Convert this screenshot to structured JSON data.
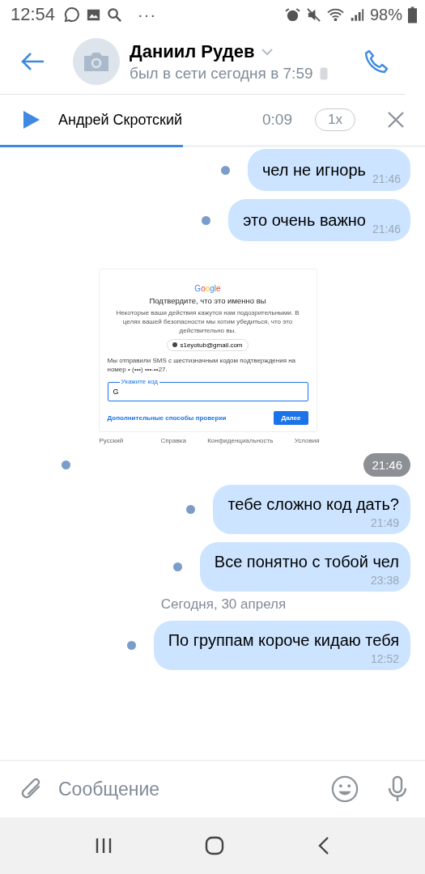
{
  "status_bar": {
    "time": "12:54",
    "more": "···",
    "battery": "98%"
  },
  "header": {
    "name": "Даниил Рудев",
    "status": "был в сети сегодня в 7:59"
  },
  "player": {
    "title": "Андрей Скротский",
    "time": "0:09",
    "speed": "1x",
    "level": 0.43
  },
  "messages": [
    {
      "kind": "text",
      "text": "чел не игнорь",
      "time": "21:46",
      "unread": true
    },
    {
      "kind": "text",
      "text": "это очень важно",
      "time": "21:46",
      "unread": true
    },
    {
      "kind": "image",
      "time": "21:46",
      "unread": true,
      "doc": {
        "brand": "Google",
        "heading": "Подтвердите, что это именно вы",
        "body": "Некоторые ваши действия кажутся нам подозрительными. В целях вашей безопасности мы хотим убедиться, что это действительно вы.",
        "account": "s1eyotub@gmail.com",
        "sms": "Мы отправили SMS с шестизначным кодом подтверждения на номер • (•••) •••-••27.",
        "field_label": "Укажите код",
        "field_value": "G",
        "link": "Дополнительные способы проверки",
        "button": "Далее",
        "footer": [
          "Русский",
          "Справка",
          "Конфиденциальность",
          "Условия"
        ]
      }
    },
    {
      "kind": "text",
      "text": "тебе сложно код дать?",
      "time": "21:49",
      "unread": true
    },
    {
      "kind": "text",
      "text": "Все понятно с тобой чел",
      "time": "23:38",
      "unread": true
    },
    {
      "kind": "date",
      "text": "Сегодня, 30 апреля"
    },
    {
      "kind": "text",
      "text": "По группам короче кидаю тебя",
      "time": "12:52",
      "unread": true
    }
  ],
  "composer": {
    "placeholder": "Сообщение"
  }
}
